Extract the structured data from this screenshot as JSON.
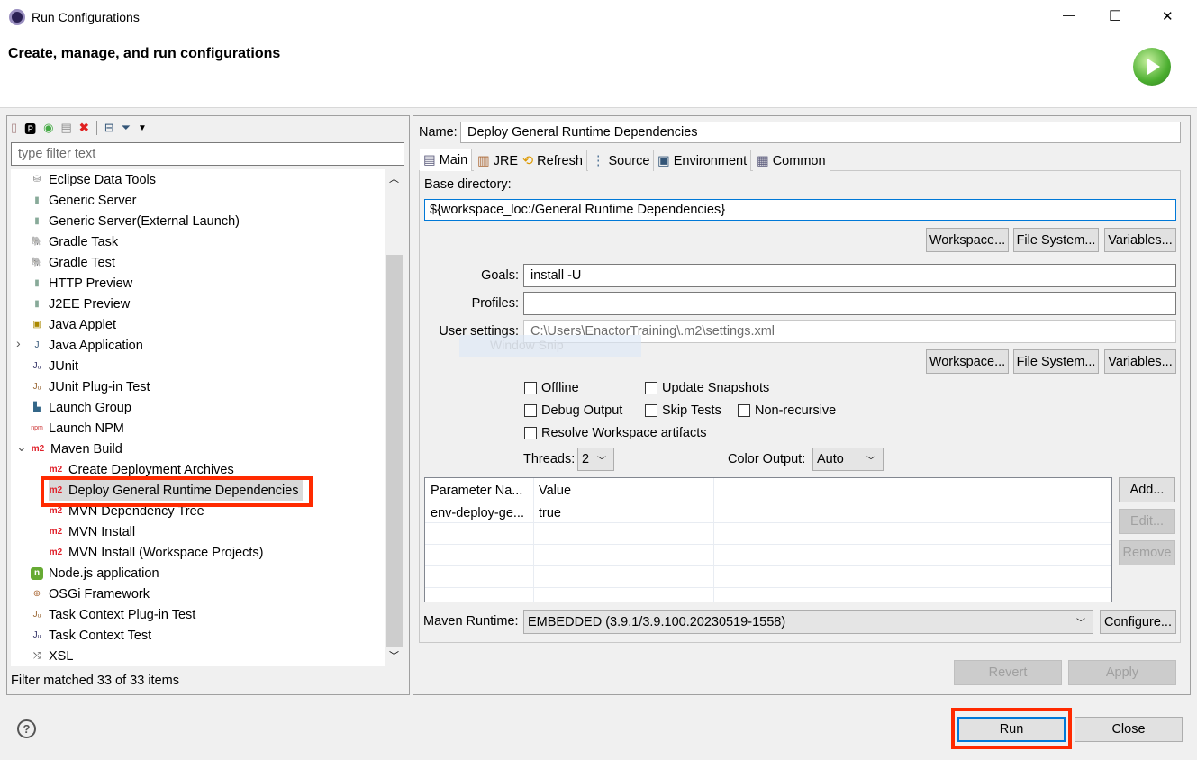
{
  "window": {
    "title": "Run Configurations",
    "minimize": "—",
    "maximize": "☐",
    "close": "✕"
  },
  "header": {
    "title": "Create, manage, and run configurations"
  },
  "left": {
    "filter_placeholder": "type filter text",
    "status": "Filter matched 33 of 33 items",
    "items": [
      {
        "label": "Eclipse Data Tools",
        "level": 0,
        "icon": "database-icon"
      },
      {
        "label": "Generic Server",
        "level": 0,
        "icon": "server-icon"
      },
      {
        "label": "Generic Server(External Launch)",
        "level": 0,
        "icon": "server-icon"
      },
      {
        "label": "Gradle Task",
        "level": 0,
        "icon": "gradle-icon"
      },
      {
        "label": "Gradle Test",
        "level": 0,
        "icon": "gradle-test-icon"
      },
      {
        "label": "HTTP Preview",
        "level": 0,
        "icon": "server-icon"
      },
      {
        "label": "J2EE Preview",
        "level": 0,
        "icon": "server-icon"
      },
      {
        "label": "Java Applet",
        "level": 0,
        "icon": "applet-icon"
      },
      {
        "label": "Java Application",
        "level": 0,
        "icon": "java-app-icon",
        "expander": "collapsed"
      },
      {
        "label": "JUnit",
        "level": 0,
        "icon": "junit-icon"
      },
      {
        "label": "JUnit Plug-in Test",
        "level": 0,
        "icon": "junit-plugin-icon"
      },
      {
        "label": "Launch Group",
        "level": 0,
        "icon": "launch-group-icon"
      },
      {
        "label": "Launch NPM",
        "level": 0,
        "icon": "npm-icon"
      },
      {
        "label": "Maven Build",
        "level": 0,
        "icon": "m2-icon",
        "expander": "expanded"
      },
      {
        "label": "Create Deployment Archives",
        "level": 1,
        "icon": "m2-icon"
      },
      {
        "label": "Deploy General Runtime Dependencies",
        "level": 1,
        "icon": "m2-icon",
        "selected": true
      },
      {
        "label": "MVN Dependency Tree",
        "level": 1,
        "icon": "m2-icon"
      },
      {
        "label": "MVN Install",
        "level": 1,
        "icon": "m2-icon"
      },
      {
        "label": "MVN Install (Workspace Projects)",
        "level": 1,
        "icon": "m2-icon"
      },
      {
        "label": "Node.js application",
        "level": 0,
        "icon": "nodejs-icon"
      },
      {
        "label": "OSGi Framework",
        "level": 0,
        "icon": "osgi-icon"
      },
      {
        "label": "Task Context Plug-in Test",
        "level": 0,
        "icon": "junit-plugin-icon"
      },
      {
        "label": "Task Context Test",
        "level": 0,
        "icon": "junit-icon"
      },
      {
        "label": "XSL",
        "level": 0,
        "icon": "xsl-icon"
      }
    ]
  },
  "right": {
    "name_label": "Name:",
    "name_value": "Deploy General Runtime Dependencies",
    "tabs": [
      "Main",
      "JRE",
      "Refresh",
      "Source",
      "Environment",
      "Common"
    ],
    "base_dir_label": "Base directory:",
    "base_dir_value": "${workspace_loc:/General Runtime Dependencies}",
    "workspace": "Workspace...",
    "file_system": "File System...",
    "variables": "Variables...",
    "goals_label": "Goals:",
    "goals_value": "install -U",
    "profiles_label": "Profiles:",
    "profiles_value": "",
    "user_settings_label": "User settings:",
    "user_settings_value": "C:\\Users\\EnactorTraining\\.m2\\settings.xml",
    "overlay": "Window Snip",
    "checkboxes": {
      "offline": "Offline",
      "update_snapshots": "Update Snapshots",
      "debug_output": "Debug Output",
      "skip_tests": "Skip Tests",
      "non_recursive": "Non-recursive",
      "resolve_workspace": "Resolve Workspace artifacts"
    },
    "threads_label": "Threads:",
    "threads_value": "2",
    "color_output_label": "Color Output:",
    "color_output_value": "Auto",
    "table": {
      "headers": [
        "Parameter Na...",
        "Value"
      ],
      "rows": [
        [
          "env-deploy-ge...",
          "true"
        ]
      ]
    },
    "add": "Add...",
    "edit": "Edit...",
    "remove": "Remove",
    "maven_runtime_label": "Maven Runtime:",
    "maven_runtime_value": "EMBEDDED (3.9.1/3.9.100.20230519-1558)",
    "configure": "Configure...",
    "revert": "Revert",
    "apply": "Apply"
  },
  "footer": {
    "help": "?",
    "run": "Run",
    "close": "Close"
  },
  "colors": {
    "highlight": "#ff2a00",
    "focus": "#0078d7",
    "m2": "#e0202a"
  }
}
